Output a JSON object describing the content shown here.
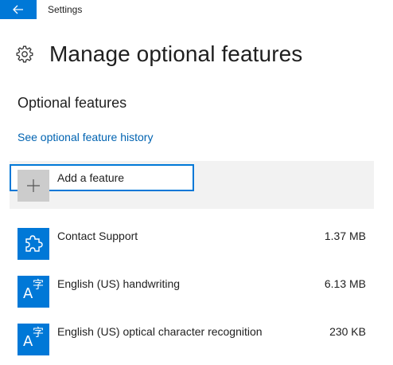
{
  "window": {
    "app_title": "Settings",
    "accent_color": "#0078d7"
  },
  "header": {
    "title": "Manage optional features",
    "icon": "gear-icon"
  },
  "section": {
    "title": "Optional features",
    "history_link": "See optional feature history"
  },
  "add_feature": {
    "label": "Add a feature",
    "icon": "plus-icon"
  },
  "features": [
    {
      "name": "Contact Support",
      "size": "1.37 MB",
      "icon": "puzzle-icon"
    },
    {
      "name": "English (US) handwriting",
      "size": "6.13 MB",
      "icon": "language-icon",
      "glyph_big": "A",
      "glyph_small": "字"
    },
    {
      "name": "English (US) optical character recognition",
      "size": "230 KB",
      "icon": "language-icon",
      "glyph_big": "A",
      "glyph_small": "字"
    }
  ]
}
